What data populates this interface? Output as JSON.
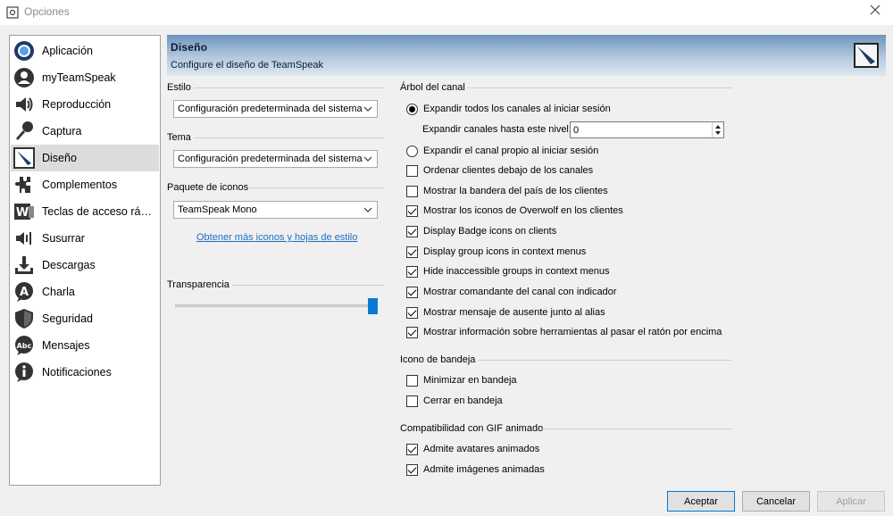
{
  "window": {
    "title": "Opciones"
  },
  "sidebar": {
    "items": [
      {
        "label": "Aplicación",
        "icon": "app-icon"
      },
      {
        "label": "myTeamSpeak",
        "icon": "user-icon"
      },
      {
        "label": "Reproducción",
        "icon": "speaker-icon"
      },
      {
        "label": "Captura",
        "icon": "microphone-icon"
      },
      {
        "label": "Diseño",
        "icon": "design-icon",
        "selected": true
      },
      {
        "label": "Complementos",
        "icon": "puzzle-icon"
      },
      {
        "label": "Teclas de acceso rápi...",
        "icon": "hotkey-icon"
      },
      {
        "label": "Susurrar",
        "icon": "whisper-icon"
      },
      {
        "label": "Descargas",
        "icon": "download-icon"
      },
      {
        "label": "Charla",
        "icon": "chat-icon"
      },
      {
        "label": "Seguridad",
        "icon": "shield-icon"
      },
      {
        "label": "Mensajes",
        "icon": "messages-icon"
      },
      {
        "label": "Notificaciones",
        "icon": "info-icon"
      }
    ]
  },
  "header": {
    "title": "Diseño",
    "subtitle": "Configure el diseño de TeamSpeak"
  },
  "left": {
    "style": {
      "label": "Estilo",
      "value": "Configuración predeterminada del sistema"
    },
    "theme": {
      "label": "Tema",
      "value": "Configuración predeterminada del sistema"
    },
    "iconpack": {
      "label": "Paquete de iconos",
      "value": "TeamSpeak Mono"
    },
    "link": "Obtener más iconos y hojas de estilo",
    "transparency": {
      "label": "Transparencia",
      "value_fraction": 1.0
    }
  },
  "tree": {
    "label": "Árbol del canal",
    "radio_expand_all": "Expandir todos los canales al iniciar sesión",
    "expand_level_label": "Expandir canales hasta este nivel:",
    "expand_level_value": "0",
    "radio_expand_own": "Expandir el canal propio al iniciar sesión",
    "checks": [
      {
        "label": "Ordenar clientes debajo de los canales",
        "checked": false
      },
      {
        "label": "Mostrar la bandera del país de los clientes",
        "checked": false
      },
      {
        "label": "Mostrar los iconos de Overwolf en los clientes",
        "checked": true
      },
      {
        "label": "Display Badge icons on clients",
        "checked": true
      },
      {
        "label": "Display group icons in context menus",
        "checked": true
      },
      {
        "label": "Hide inaccessible groups in context menus",
        "checked": true
      },
      {
        "label": "Mostrar comandante del canal con indicador",
        "checked": true
      },
      {
        "label": "Mostrar mensaje de ausente junto al alias",
        "checked": true
      },
      {
        "label": "Mostrar información sobre herramientas al pasar el ratón por encima",
        "checked": true
      }
    ]
  },
  "tray": {
    "label": "Icono de bandeja",
    "minimize": "Minimizar en bandeja",
    "close": "Cerrar en bandeja"
  },
  "gif": {
    "label": "Compatibilidad con GIF animado",
    "avatars": "Admite avatares animados",
    "images": "Admite imágenes animadas"
  },
  "buttons": {
    "ok": "Aceptar",
    "cancel": "Cancelar",
    "apply": "Aplicar"
  }
}
